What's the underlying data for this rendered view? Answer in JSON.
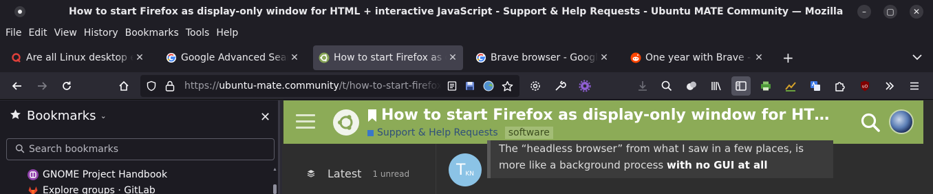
{
  "window": {
    "title": "How to start Firefox as display-only window for HTML + interactive JavaScript - Support & Help Requests - Ubuntu MATE Community — Mozilla Firefox",
    "minimize_glyph": "–",
    "maximize_glyph": "▢",
    "close_glyph": "✕"
  },
  "menubar": {
    "items": [
      "File",
      "Edit",
      "View",
      "History",
      "Bookmarks",
      "Tools",
      "Help"
    ]
  },
  "tabs": [
    {
      "label": "Are all Linux desktop environments",
      "favicon": "quora-icon",
      "color": "#b92b27",
      "active": false
    },
    {
      "label": "Google Advanced Search",
      "favicon": "google-icon",
      "color": "#4285f4",
      "active": false
    },
    {
      "label": "How to start Firefox as display-only",
      "favicon": "ubuntu-mate-icon",
      "color": "#87a556",
      "active": true
    },
    {
      "label": "Brave browser - Google Search",
      "favicon": "google-icon",
      "color": "#4285f4",
      "active": false
    },
    {
      "label": "One year with Brave - A Reddit",
      "favicon": "reddit-icon",
      "color": "#ff4500",
      "active": false
    }
  ],
  "tab_close_glyph": "✕",
  "new_tab_glyph": "+",
  "navbar": {
    "url_scheme": "https://",
    "url_host": "ubuntu-mate.community",
    "url_path": "/t/how-to-start-firefox-as-display-only-window-for-html-interactive-javascript"
  },
  "sidebar": {
    "title": "Bookmarks",
    "chevron": "⌄",
    "close_glyph": "✕",
    "search_placeholder": "Search bookmarks",
    "items": [
      {
        "label": "GNOME Project Handbook",
        "favicon": "gnome-icon",
        "color": "#9141ac"
      },
      {
        "label": "Explore groups · GitLab",
        "favicon": "gitlab-icon",
        "color": "#e24329"
      }
    ]
  },
  "discourse": {
    "topic_title": "How to start Firefox as display-only window for HTML + interactive JavaScript",
    "category": "Support & Help Requests",
    "tag": "software",
    "nav_latest": "Latest",
    "nav_latest_count": "1 unread",
    "post_avatar_letter": "T",
    "post_avatar_sub": "KN",
    "quote_text": "The “headless browser” from what I saw in a few places, is more like a background process ",
    "quote_bold": "with no GUI at all",
    "colors": {
      "header_bg": "#8cab57",
      "content_bg": "#2e2e2e",
      "category": "#3a77c9"
    }
  }
}
